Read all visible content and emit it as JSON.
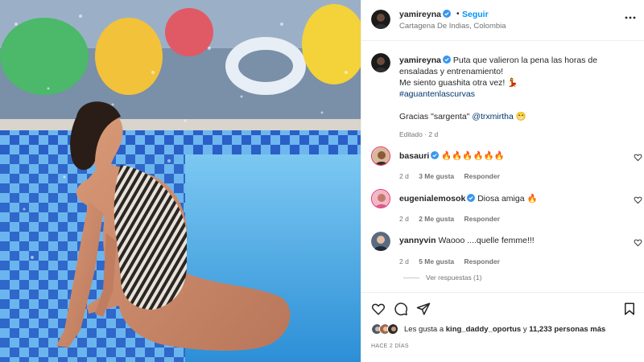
{
  "post": {
    "username": "yamireyna",
    "follow_label": "Seguir",
    "separator": "•",
    "location": "Cartagena De Indias, Colombia",
    "more_icon": "more-horizontal-icon"
  },
  "caption": {
    "username": "yamireyna",
    "text_1": "Puta que valieron la pena las horas de ensaladas y entrenamiento!",
    "text_2": "Me siento guashita otra vez! 💃",
    "hashtag": "#aguantenlascurvas",
    "text_3": "Gracias \"sargenta\"",
    "mention": "@trxmirtha",
    "emoji_3": "😁",
    "meta": "Editado · 2 d"
  },
  "comments": [
    {
      "username": "basauri",
      "text": "🔥🔥🔥🔥🔥🔥",
      "time": "2 d",
      "likes": "3 Me gusta",
      "reply": "Responder"
    },
    {
      "username": "eugenialemosok",
      "text": "Diosa amiga 🔥",
      "time": "2 d",
      "likes": "2 Me gusta",
      "reply": "Responder"
    },
    {
      "username": "yannyvin",
      "text": "Waooo ....quelle femme!!!",
      "time": "2 d",
      "likes": "5 Me gusta",
      "reply": "Responder"
    }
  ],
  "replies_label": "Ver respuestas (1)",
  "actions": {
    "like_icon": "heart-icon",
    "comment_icon": "comment-icon",
    "share_icon": "share-icon",
    "save_icon": "bookmark-icon"
  },
  "likes": {
    "prefix": "Les gusta a",
    "user": "king_daddy_oportus",
    "conj": "y",
    "count": "11,233 personas más"
  },
  "time_ago": "HACE 2 DÍAS",
  "colors": {
    "accent": "#0095f6",
    "verified": "#3897f0",
    "muted": "#737373"
  }
}
